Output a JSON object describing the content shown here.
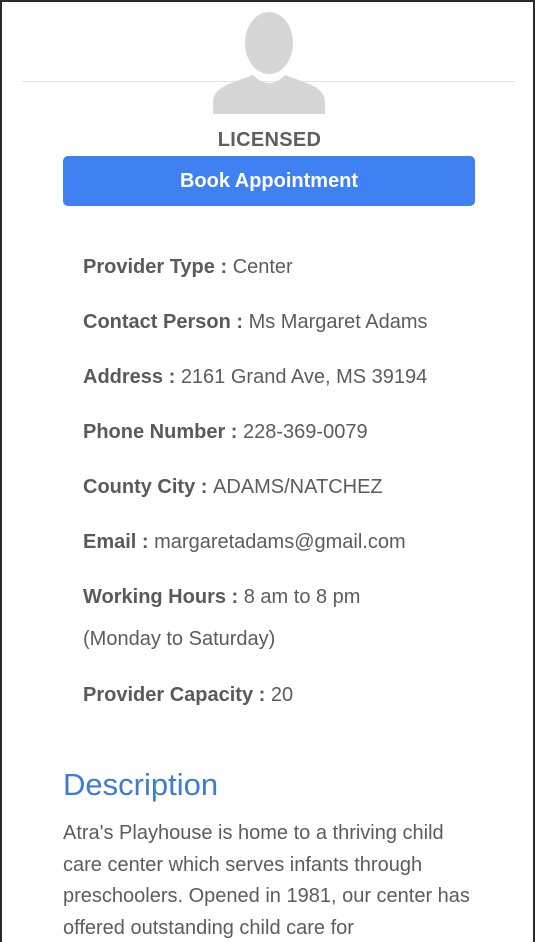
{
  "profile": {
    "status": "LICENSED",
    "book_button": "Book Appointment"
  },
  "details": [
    {
      "label": "Provider Type",
      "value": "Center"
    },
    {
      "label": "Contact Person",
      "value": "Ms Margaret Adams"
    },
    {
      "label": "Address",
      "value": "2161 Grand Ave, MS 39194"
    },
    {
      "label": "Phone Number",
      "value": "228-369-0079"
    },
    {
      "label": "County City",
      "value": "ADAMS/NATCHEZ"
    },
    {
      "label": "Email",
      "value": "margaretadams@gmail.com"
    },
    {
      "label": "Working Hours",
      "value": "8 am to 8 pm",
      "sub": "(Monday to Saturday)"
    },
    {
      "label": "Provider Capacity",
      "value": "20"
    }
  ],
  "description": {
    "title": "Description",
    "body": "Atra's Playhouse is home to a thriving child care center which serves infants through preschoolers. Opened in 1981, our center has offered outstanding child care for"
  },
  "separator": " : "
}
